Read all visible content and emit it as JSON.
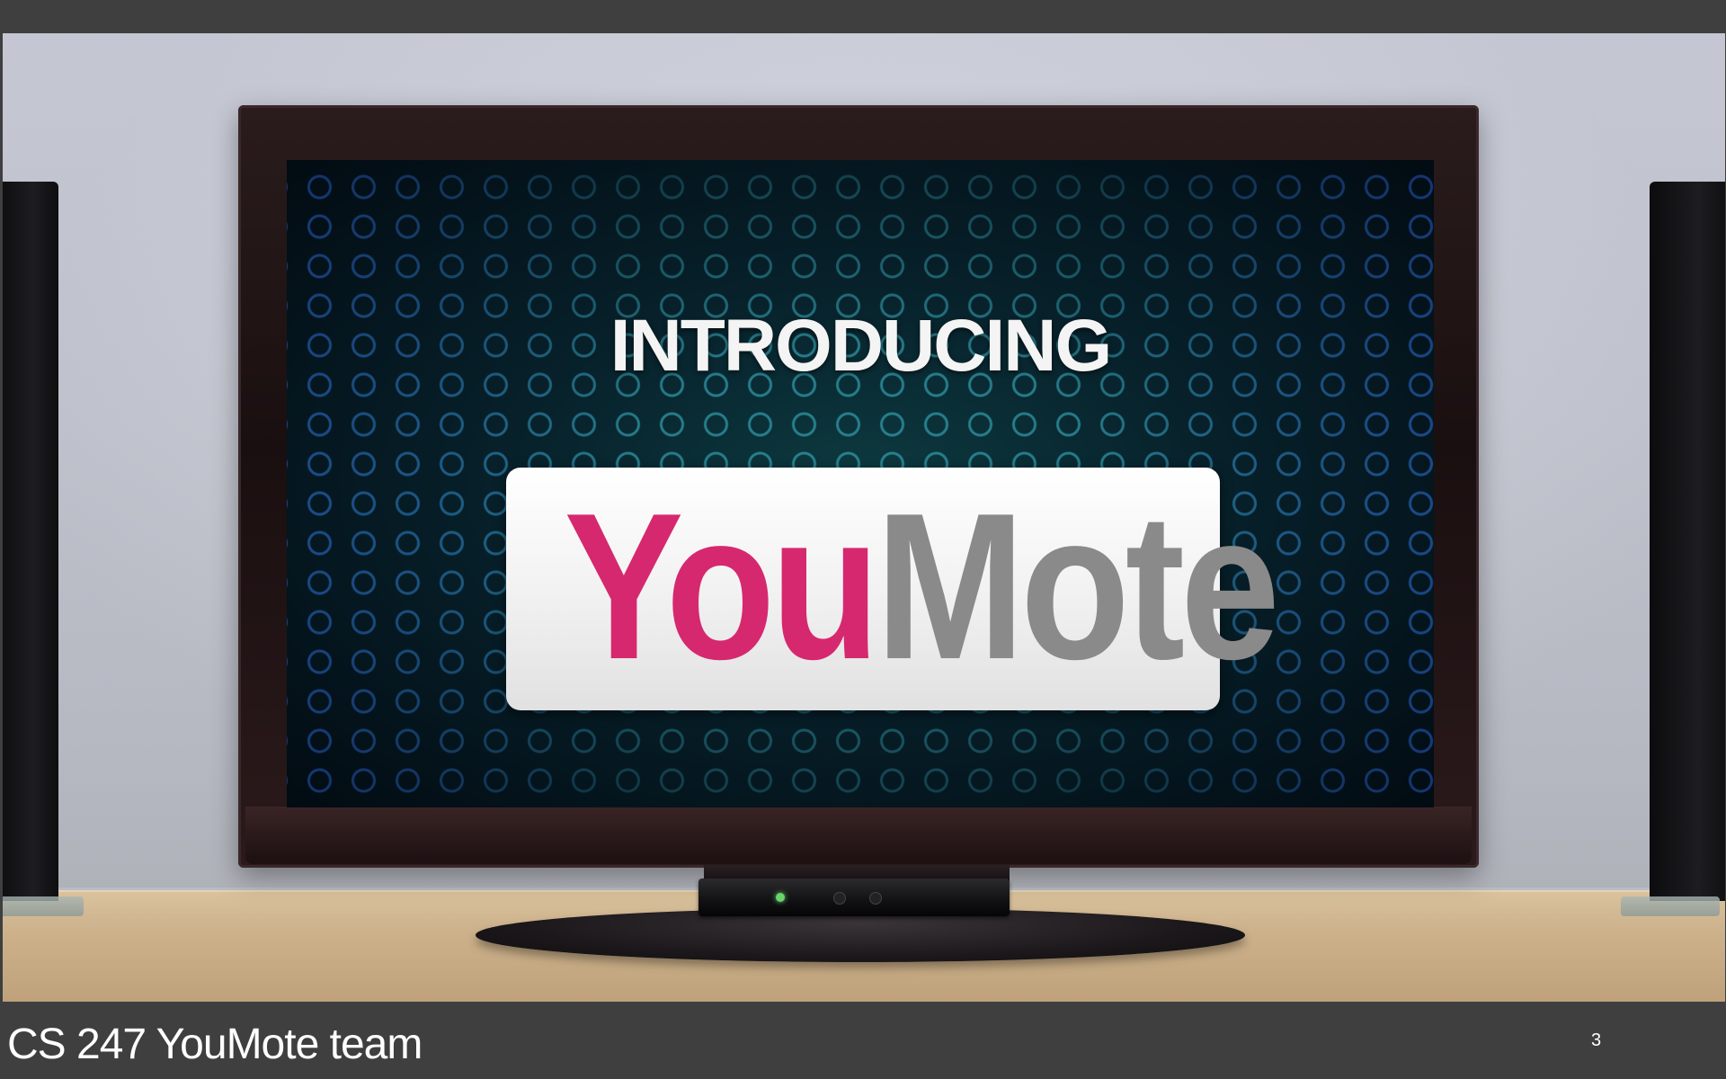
{
  "slide": {
    "screen": {
      "intro_text": "INTRODUCING",
      "logo_part1": "You",
      "logo_part2": "Mote"
    },
    "footer_title": "CS 247 YouMote team",
    "page_number": "3"
  },
  "colors": {
    "logo_you": "#d6286f",
    "logo_mote": "#8a8a8a",
    "footer_bg": "#3f3f3f"
  }
}
